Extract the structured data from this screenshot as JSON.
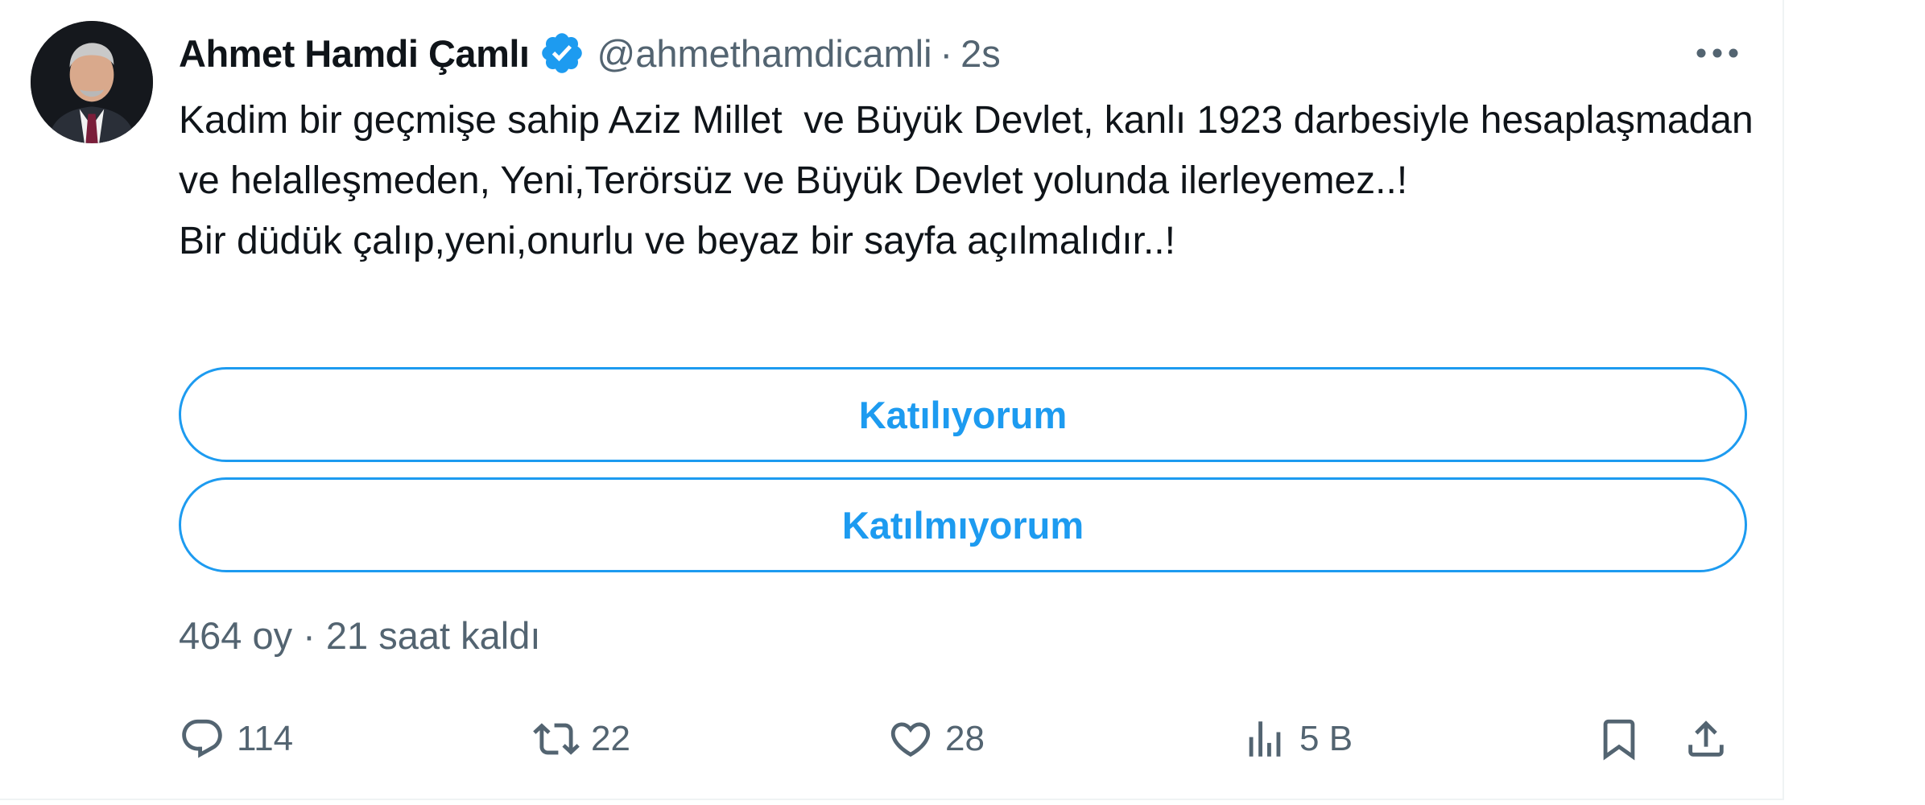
{
  "author": {
    "display_name": "Ahmet Hamdi Çamlı",
    "handle": "@ahmethamdicamli",
    "separator": "·",
    "time": "2s",
    "avatar_icon": "profile-photo",
    "verified_icon": "verified-badge-icon",
    "verified_color": "#1d9bf0"
  },
  "tweet": {
    "text": "Kadim bir geçmişe sahip Aziz Millet  ve Büyük Devlet, kanlı 1923 darbesiyle hesaplaşmadan ve helalleşmeden, Yeni,Terörsüz ve Büyük Devlet yolunda ilerleyemez..!\nBir düdük çalıp,yeni,onurlu ve beyaz bir sayfa açılmalıdır..!"
  },
  "poll": {
    "options": [
      {
        "label": "Katılıyorum"
      },
      {
        "label": "Katılmıyorum"
      }
    ],
    "meta": "464 oy · 21 saat kaldı",
    "accent_color": "#1d9bf0"
  },
  "actions": {
    "reply": {
      "icon": "reply-icon",
      "count": "114"
    },
    "retweet": {
      "icon": "retweet-icon",
      "count": "22"
    },
    "like": {
      "icon": "heart-icon",
      "count": "28"
    },
    "views": {
      "icon": "views-chart-icon",
      "count": "5 B"
    },
    "bookmark": {
      "icon": "bookmark-icon"
    },
    "share": {
      "icon": "share-icon"
    }
  },
  "more_icon": "more-horizontal-icon",
  "colors": {
    "text_primary": "#0f1419",
    "text_secondary": "#536471",
    "divider": "#eff3f4"
  }
}
